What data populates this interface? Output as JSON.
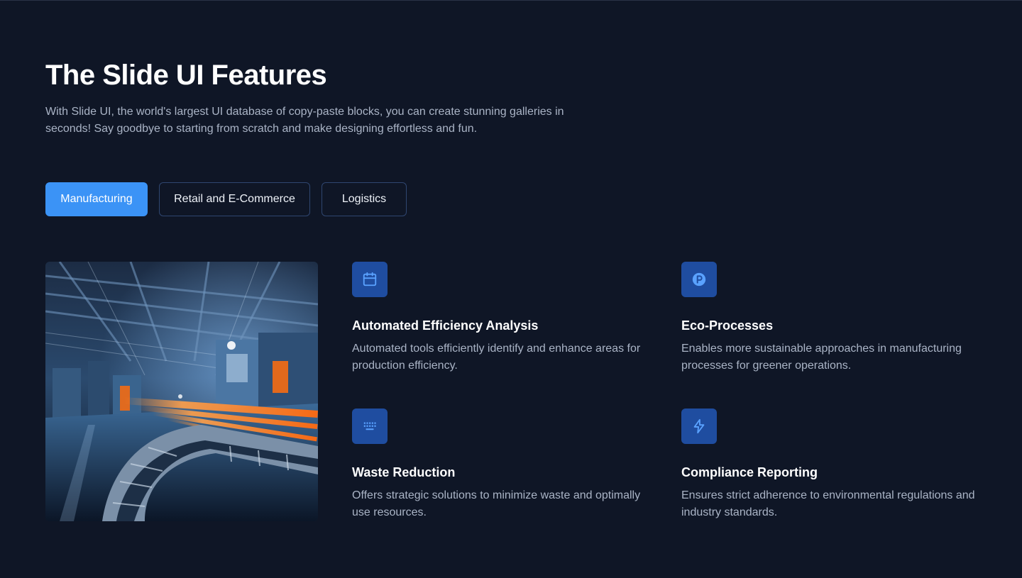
{
  "header": {
    "title": "The Slide UI Features",
    "description": "With Slide UI, the world's largest UI database of copy-paste blocks, you can create stunning galleries in seconds! Say goodbye to starting from scratch and make designing effortless and fun."
  },
  "tabs": [
    {
      "label": "Manufacturing",
      "active": true
    },
    {
      "label": "Retail and E-Commerce",
      "active": false
    },
    {
      "label": "Logistics",
      "active": false
    }
  ],
  "features": [
    {
      "icon": "calendar-icon",
      "title": "Automated Efficiency Analysis",
      "text": "Automated tools efficiently identify and enhance areas for production efficiency."
    },
    {
      "icon": "parking-icon",
      "title": "Eco-Processes",
      "text": "Enables more sustainable approaches in manufacturing processes for greener operations."
    },
    {
      "icon": "keyboard-icon",
      "title": "Waste Reduction",
      "text": "Offers strategic solutions to minimize waste and optimally use resources."
    },
    {
      "icon": "lightning-icon",
      "title": "Compliance Reporting",
      "text": "Ensures strict adherence to environmental regulations and industry standards."
    }
  ],
  "colors": {
    "background": "#0f1626",
    "accent": "#3b93f6",
    "icon_box": "#1f4da0",
    "icon_stroke": "#5aa2ff",
    "body_text": "#aab4c6"
  }
}
